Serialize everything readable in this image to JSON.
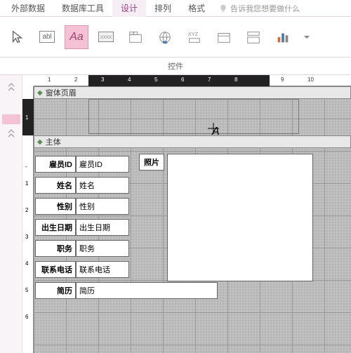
{
  "tabs": {
    "external_data": "外部数据",
    "db_tools": "数据库工具",
    "design": "设计",
    "arrange": "排列",
    "format": "格式",
    "tellme": "告诉我您想要做什么"
  },
  "ribbon_group": "控件",
  "ribbon": {
    "select": "select",
    "textbox": "abl",
    "label": "Aa",
    "button": "xxxx"
  },
  "sections": {
    "form_header": "窗体页眉",
    "body": "主体"
  },
  "fields": {
    "emp_id_label": "雇员ID",
    "emp_id_value": "雇员ID",
    "name_label": "姓名",
    "name_value": "姓名",
    "gender_label": "性别",
    "gender_value": "性别",
    "birth_label": "出生日期",
    "birth_value": "出生日期",
    "title_label": "职务",
    "title_value": "职务",
    "phone_label": "联系电话",
    "phone_value": "联系电话",
    "photo_label": "照片",
    "resume_label": "简历",
    "resume_value": "简历"
  },
  "ruler": {
    "marks": [
      "1",
      "2",
      "3",
      "4",
      "5",
      "6",
      "7",
      "8",
      "9",
      "10"
    ]
  }
}
